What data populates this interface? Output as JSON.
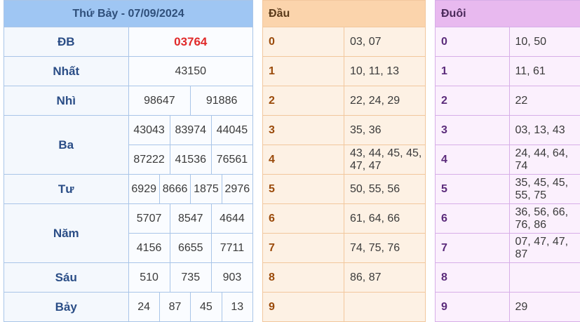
{
  "results": {
    "title": "Thứ Bảy - 07/09/2024",
    "rows": [
      {
        "label": "ĐB",
        "values": [
          "03764"
        ]
      },
      {
        "label": "Nhất",
        "values": [
          "43150"
        ]
      },
      {
        "label": "Nhì",
        "values": [
          "98647",
          "91886"
        ]
      },
      {
        "label": "Ba",
        "values": [
          "43043",
          "83974",
          "44045",
          "87222",
          "41536",
          "76561"
        ]
      },
      {
        "label": "Tư",
        "values": [
          "6929",
          "8666",
          "1875",
          "2976"
        ]
      },
      {
        "label": "Năm",
        "values": [
          "5707",
          "8547",
          "4644",
          "4156",
          "6655",
          "7711"
        ]
      },
      {
        "label": "Sáu",
        "values": [
          "510",
          "735",
          "903"
        ]
      },
      {
        "label": "Bảy",
        "values": [
          "24",
          "87",
          "45",
          "13"
        ]
      }
    ]
  },
  "dau": {
    "header": "Đầu",
    "rows": [
      {
        "digit": "0",
        "values": "03, 07"
      },
      {
        "digit": "1",
        "values": "10, 11, 13"
      },
      {
        "digit": "2",
        "values": "22, 24, 29"
      },
      {
        "digit": "3",
        "values": "35, 36"
      },
      {
        "digit": "4",
        "values": "43, 44, 45, 45, 47, 47"
      },
      {
        "digit": "5",
        "values": "50, 55, 56"
      },
      {
        "digit": "6",
        "values": "61, 64, 66"
      },
      {
        "digit": "7",
        "values": "74, 75, 76"
      },
      {
        "digit": "8",
        "values": "86, 87"
      },
      {
        "digit": "9",
        "values": ""
      }
    ]
  },
  "duoi": {
    "header": "Đuôi",
    "rows": [
      {
        "digit": "0",
        "values": "10, 50"
      },
      {
        "digit": "1",
        "values": "11, 61"
      },
      {
        "digit": "2",
        "values": "22"
      },
      {
        "digit": "3",
        "values": "03, 13, 43"
      },
      {
        "digit": "4",
        "values": "24, 44, 64, 74"
      },
      {
        "digit": "5",
        "values": "35, 45, 45, 55, 75"
      },
      {
        "digit": "6",
        "values": "36, 56, 66, 76, 86"
      },
      {
        "digit": "7",
        "values": "07, 47, 47, 87"
      },
      {
        "digit": "8",
        "values": ""
      },
      {
        "digit": "9",
        "values": "29"
      }
    ]
  },
  "colors": {
    "special_prize": "#e02a2a",
    "results_header": "#9fc6f3",
    "dau_header": "#fbd4ac",
    "duoi_header": "#e8b9ef"
  }
}
